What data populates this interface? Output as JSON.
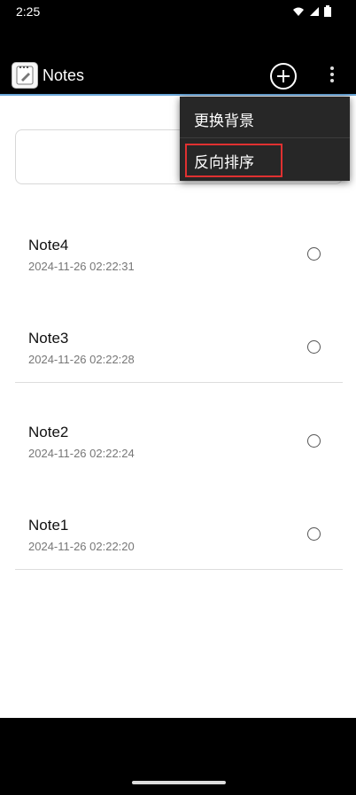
{
  "status_bar": {
    "time": "2:25",
    "wifi_icon": "wifi-icon",
    "signal_icon": "signal-icon",
    "battery_icon": "battery-icon"
  },
  "app_bar": {
    "title": "Notes",
    "app_icon": "notepad-icon",
    "add_icon": "add-circle-icon",
    "overflow_icon": "more-vertical-icon"
  },
  "search": {
    "value": "",
    "placeholder": ""
  },
  "notes": [
    {
      "title": "Note4",
      "timestamp": "2024-11-26 02:22:31"
    },
    {
      "title": "Note3",
      "timestamp": "2024-11-26 02:22:28"
    },
    {
      "title": "Note2",
      "timestamp": "2024-11-26 02:22:24"
    },
    {
      "title": "Note1",
      "timestamp": "2024-11-26 02:22:20"
    }
  ],
  "menu": {
    "items": [
      {
        "label": "更换背景"
      },
      {
        "label": "反向排序"
      }
    ]
  },
  "colors": {
    "accent": "#6aa6d8",
    "highlight": "#e03131",
    "menu_bg": "#272727"
  }
}
